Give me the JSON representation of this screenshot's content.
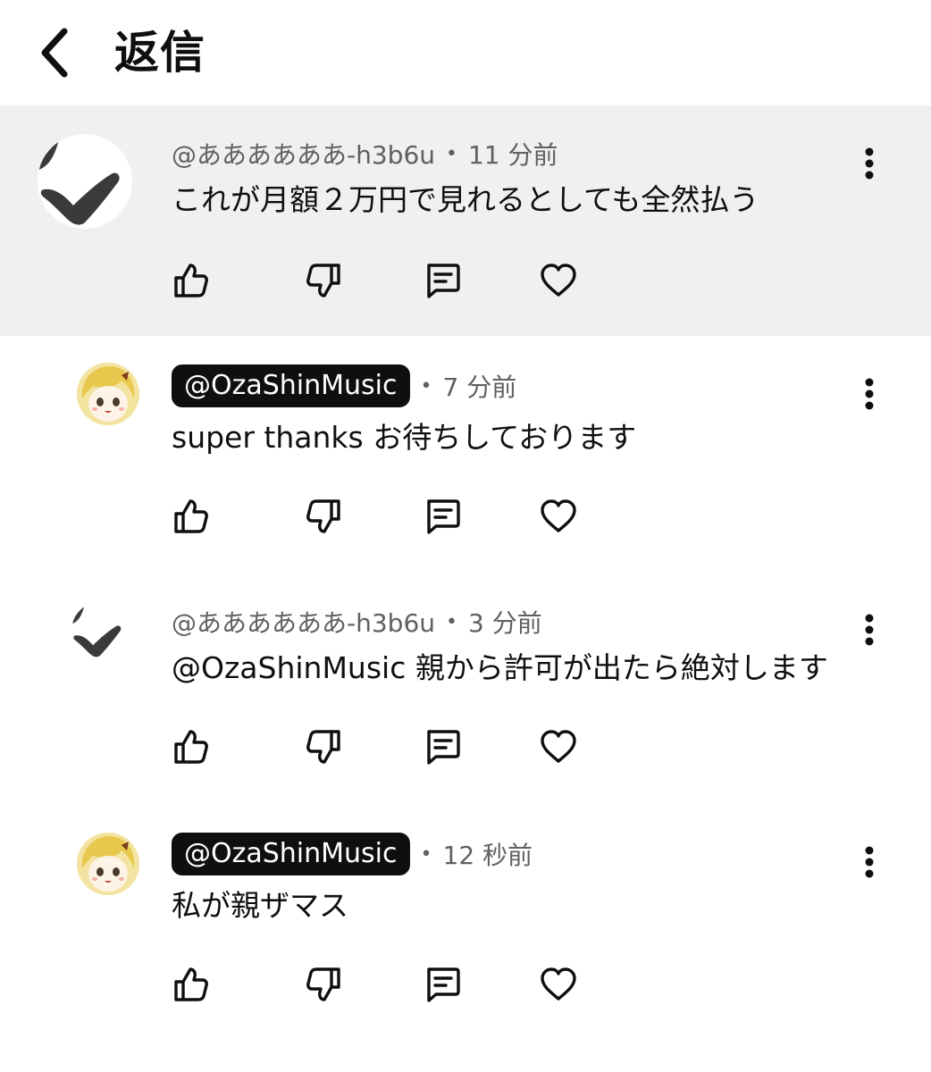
{
  "header": {
    "title": "返信"
  },
  "comments": [
    {
      "author": "@ああああああ-h3b6u",
      "author_is_creator": false,
      "time": "11 分前",
      "text": "これが月額２万円で見れるとしても全然払う",
      "avatar_icon": "check-logo-icon",
      "highlighted": true
    },
    {
      "author": "@OzaShinMusic",
      "author_is_creator": true,
      "time": "7 分前",
      "text": "super thanks お待ちしております",
      "avatar_icon": "anime-girl-avatar"
    },
    {
      "author": "@ああああああ-h3b6u",
      "author_is_creator": false,
      "time": "3 分前",
      "text": "@OzaShinMusic 親から許可が出たら絶対します",
      "avatar_icon": "check-logo-icon"
    },
    {
      "author": "@OzaShinMusic",
      "author_is_creator": true,
      "time": "12 秒前",
      "text": "私が親ザマス",
      "avatar_icon": "anime-girl-avatar"
    }
  ],
  "action_icons": [
    "like-icon",
    "dislike-icon",
    "reply-icon",
    "heart-icon"
  ],
  "colors": {
    "highlight_background": "#f0f0f0",
    "creator_badge": "#0f0f0f",
    "meta_text": "#606060"
  }
}
